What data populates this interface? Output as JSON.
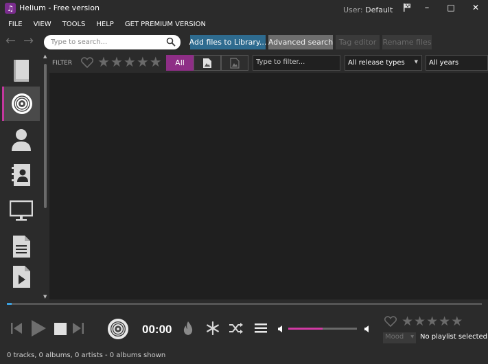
{
  "window": {
    "title": "Helium - Free version",
    "user_prefix": "User:",
    "user_name": "Default",
    "minimize": "–",
    "maximize": "□",
    "close": "✕"
  },
  "menu": {
    "items": [
      "FILE",
      "VIEW",
      "TOOLS",
      "HELP",
      "GET PREMIUM VERSION"
    ]
  },
  "toolbar": {
    "search_placeholder": "Type to search...",
    "add_files_label": "Add files to Library...",
    "advanced_search_label": "Advanced search",
    "tag_editor_label": "Tag editor",
    "rename_files_label": "Rename files"
  },
  "sidebar": {
    "items": [
      {
        "icon": "book-icon",
        "active": false
      },
      {
        "icon": "disc-icon",
        "active": true
      },
      {
        "icon": "person-icon",
        "active": false
      },
      {
        "icon": "contact-book-icon",
        "active": false
      },
      {
        "icon": "monitor-icon",
        "active": false
      },
      {
        "icon": "document-icon",
        "active": false
      },
      {
        "icon": "video-file-icon",
        "active": false
      }
    ]
  },
  "filter": {
    "label": "FILTER",
    "rating_stars": 5,
    "all_label": "All",
    "filter_placeholder": "Type to filter...",
    "release_types": "All release types",
    "years": "All years"
  },
  "player": {
    "time": "00:00",
    "volume": 0.5,
    "progress": 0.01,
    "mood_label": "Mood",
    "playlist_status": "No playlist selected",
    "rating_stars": 5
  },
  "status": {
    "text": "0 tracks, 0 albums, 0 artists - 0 albums shown"
  },
  "colors": {
    "accent": "#c3379e",
    "all_button": "#8e2e86",
    "add_button": "#2e6b8f",
    "progress": "#3aa0e0",
    "volume": "#d23aa4"
  }
}
